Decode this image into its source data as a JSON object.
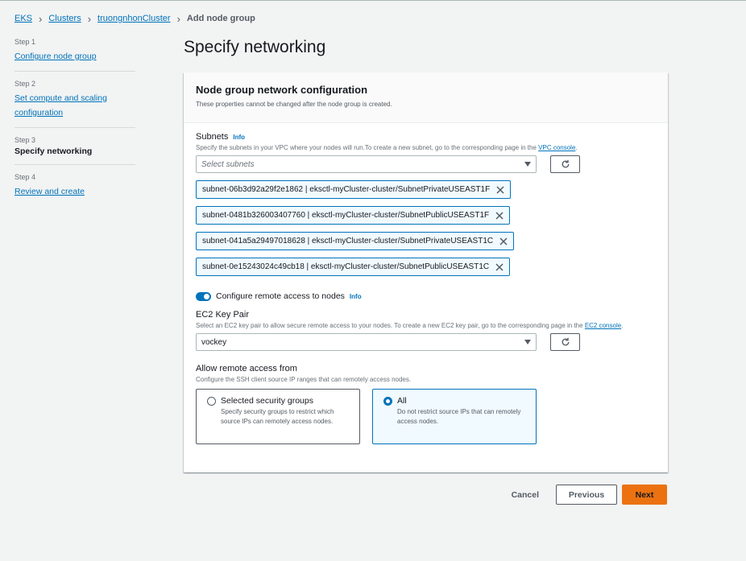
{
  "breadcrumb": {
    "items": [
      "EKS",
      "Clusters",
      "truongnhonCluster"
    ],
    "current": "Add node group"
  },
  "steps": [
    {
      "num": "Step 1",
      "label": "Configure node group",
      "state": "link"
    },
    {
      "num": "Step 2",
      "label": "Set compute and scaling configuration",
      "state": "link"
    },
    {
      "num": "Step 3",
      "label": "Specify networking",
      "state": "current"
    },
    {
      "num": "Step 4",
      "label": "Review and create",
      "state": "link"
    }
  ],
  "page_title": "Specify networking",
  "card": {
    "title": "Node group network configuration",
    "description": "These properties cannot be changed after the node group is created."
  },
  "subnets": {
    "label": "Subnets",
    "info": "Info",
    "description": "Specify the subnets in your VPC where your nodes will run.To create a new subnet, go to the corresponding page in the",
    "link": "VPC console",
    "link_suffix": ".",
    "placeholder": "Select subnets",
    "tokens": [
      "subnet-06b3d92a29f2e1862 | eksctl-myCluster-cluster/SubnetPrivateUSEAST1F",
      "subnet-0481b326003407760 | eksctl-myCluster-cluster/SubnetPublicUSEAST1F",
      "subnet-041a5a29497018628 | eksctl-myCluster-cluster/SubnetPrivateUSEAST1C",
      "subnet-0e15243024c49cb18 | eksctl-myCluster-cluster/SubnetPublicUSEAST1C"
    ]
  },
  "remote_access": {
    "toggle_label": "Configure remote access to nodes",
    "info": "Info",
    "enabled": true
  },
  "key_pair": {
    "label": "EC2 Key Pair",
    "description": "Select an EC2 key pair to allow secure remote access to your nodes. To create a new EC2 key pair, go to the corresponding page in the",
    "link": "EC2 console",
    "link_suffix": ".",
    "value": "vockey"
  },
  "allow_from": {
    "label": "Allow remote access from",
    "description": "Configure the SSH client source IP ranges that can remotely access nodes.",
    "options": [
      {
        "title": "Selected security groups",
        "desc": "Specify security groups to restrict which source IPs can remotely access nodes.",
        "selected": false
      },
      {
        "title": "All",
        "desc": "Do not restrict source IPs that can remotely access nodes.",
        "selected": true
      }
    ]
  },
  "footer": {
    "cancel": "Cancel",
    "previous": "Previous",
    "next": "Next"
  },
  "colors": {
    "accent": "#0073bb",
    "primary_button": "#ec7211"
  }
}
